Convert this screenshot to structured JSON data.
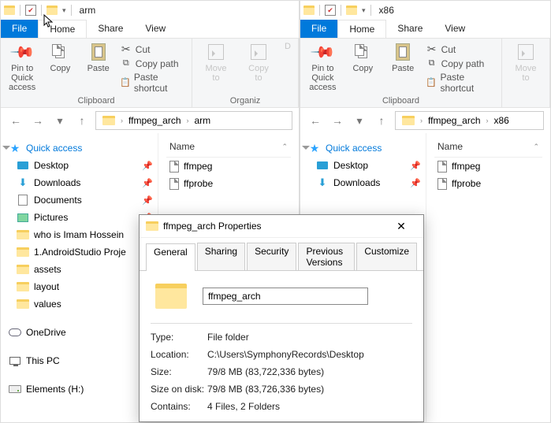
{
  "left_window": {
    "title": "arm",
    "tabs": {
      "file": "File",
      "home": "Home",
      "share": "Share",
      "view": "View"
    },
    "ribbon": {
      "pin": "Pin to Quick\naccess",
      "copy": "Copy",
      "paste": "Paste",
      "cut": "Cut",
      "copy_path": "Copy path",
      "paste_shortcut": "Paste shortcut",
      "clipboard_group": "Clipboard",
      "move": "Move\nto",
      "copy_to": "Copy\nto",
      "del": "D",
      "organize_group": "Organiz"
    },
    "breadcrumbs": [
      "ffmpeg_arch",
      "arm"
    ],
    "filelist_header": "Name",
    "files": [
      "ffmpeg",
      "ffprobe"
    ],
    "tree": {
      "quick_access": "Quick access",
      "desktop": "Desktop",
      "downloads": "Downloads",
      "documents": "Documents",
      "pictures": "Pictures",
      "f1": "who is Imam Hossein",
      "f2": "1.AndroidStudio Proje",
      "f3": "assets",
      "f4": "layout",
      "f5": "values",
      "onedrive": "OneDrive",
      "thispc": "This PC",
      "drive": "Elements (H:)"
    }
  },
  "right_window": {
    "title": "x86",
    "tabs": {
      "file": "File",
      "home": "Home",
      "share": "Share",
      "view": "View"
    },
    "ribbon": {
      "pin": "Pin to Quick\naccess",
      "copy": "Copy",
      "paste": "Paste",
      "cut": "Cut",
      "copy_path": "Copy path",
      "paste_shortcut": "Paste shortcut",
      "clipboard_group": "Clipboard",
      "move": "Move\nto",
      "organize_group": ""
    },
    "breadcrumbs": [
      "ffmpeg_arch",
      "x86"
    ],
    "filelist_header": "Name",
    "files": [
      "ffmpeg",
      "ffprobe"
    ],
    "tree": {
      "quick_access": "Quick access",
      "desktop": "Desktop",
      "downloads": "Downloads"
    }
  },
  "properties": {
    "title": "ffmpeg_arch Properties",
    "tabs": [
      "General",
      "Sharing",
      "Security",
      "Previous Versions",
      "Customize"
    ],
    "name": "ffmpeg_arch",
    "rows": {
      "type_l": "Type:",
      "type_v": "File folder",
      "location_l": "Location:",
      "location_v": "C:\\Users\\SymphonyRecords\\Desktop",
      "size_l": "Size:",
      "size_v": "79/8 MB (83,722,336 bytes)",
      "sizeondisk_l": "Size on disk:",
      "sizeondisk_v": "79/8 MB (83,726,336 bytes)",
      "contains_l": "Contains:",
      "contains_v": "4 Files, 2 Folders"
    }
  }
}
